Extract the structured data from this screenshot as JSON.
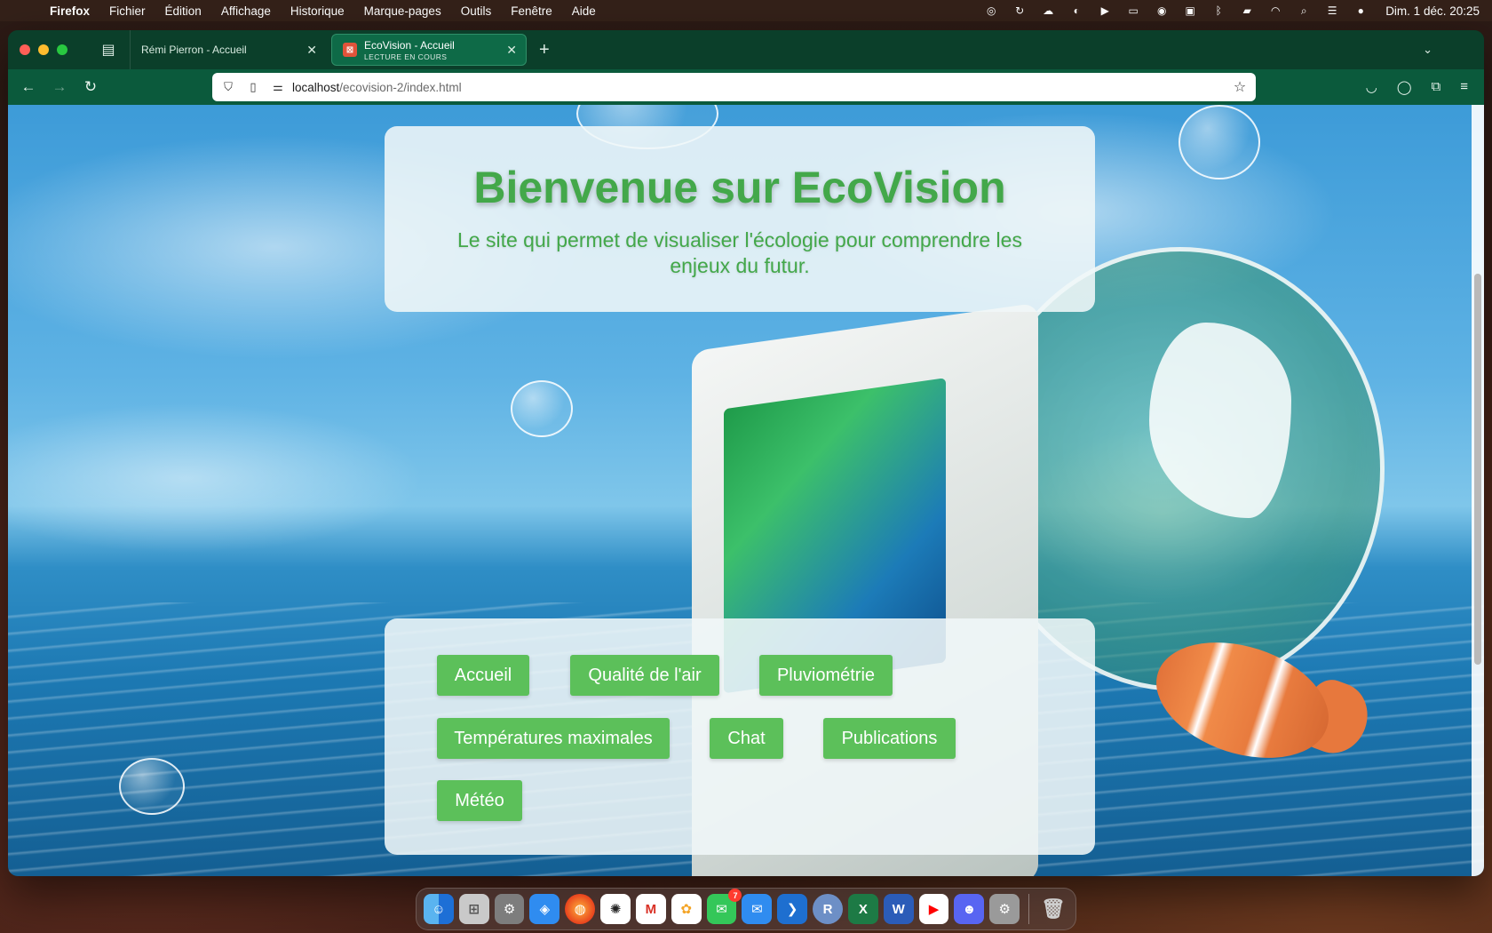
{
  "menubar": {
    "app_name": "Firefox",
    "items": [
      "Fichier",
      "Édition",
      "Affichage",
      "Historique",
      "Marque-pages",
      "Outils",
      "Fenêtre",
      "Aide"
    ],
    "clock": "Dim. 1 déc.  20:25"
  },
  "browser": {
    "tabs": [
      {
        "title": "Rémi Pierron - Accueil",
        "subtitle": "",
        "active": false
      },
      {
        "title": "EcoVision - Accueil",
        "subtitle": "LECTURE EN COURS",
        "active": true
      }
    ],
    "url_host": "localhost",
    "url_path": "/ecovision-2/index.html"
  },
  "page": {
    "hero": {
      "title": "Bienvenue sur EcoVision",
      "subtitle": "Le site qui permet de visualiser l'écologie pour comprendre les enjeux du futur."
    },
    "nav_buttons": [
      {
        "label": "Accueil"
      },
      {
        "label": "Qualité de l'air"
      },
      {
        "label": "Pluviométrie"
      },
      {
        "label": "Températures maximales"
      },
      {
        "label": "Chat"
      },
      {
        "label": "Publications"
      },
      {
        "label": "Météo"
      }
    ]
  },
  "dock": {
    "messages_badge": "7"
  },
  "colors": {
    "accent_green": "#43a84a",
    "button_green": "#5cc05a",
    "browser_theme": "#0b3f2a"
  }
}
